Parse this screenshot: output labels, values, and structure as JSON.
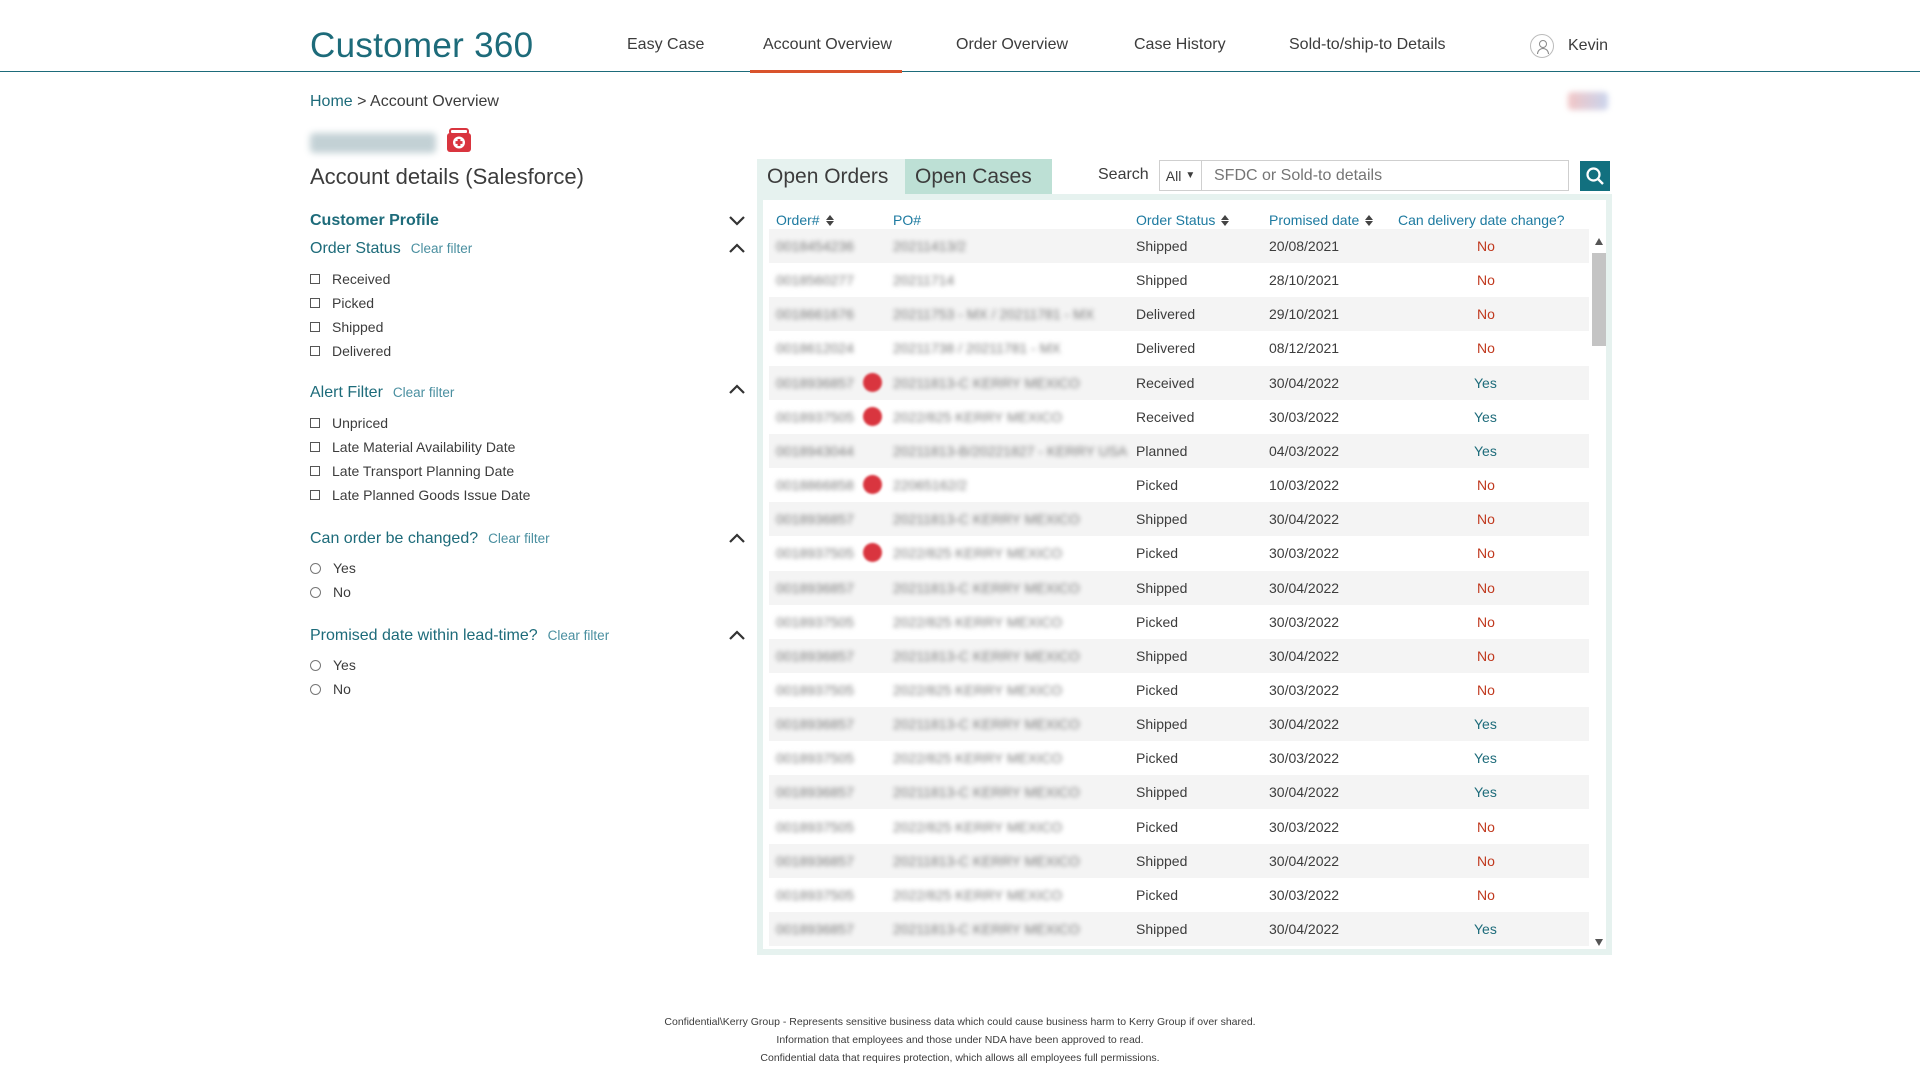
{
  "header": {
    "brand": "Customer 360",
    "nav": [
      "Easy Case",
      "Account Overview",
      "Order Overview",
      "Case History",
      "Sold-to/ship-to Details"
    ],
    "active_nav": "Account Overview",
    "user_name": "Kevin"
  },
  "breadcrumb": {
    "home": "Home",
    "separator": " > ",
    "current": "Account Overview"
  },
  "account": {
    "section_title": "Account details (Salesforce)",
    "aid_icon": "first-aid-kit-icon"
  },
  "filters": {
    "customer_profile": {
      "title": "Customer Profile"
    },
    "order_status": {
      "title": "Order Status",
      "clear": "Clear filter",
      "options": [
        "Received",
        "Picked",
        "Shipped",
        "Delivered"
      ]
    },
    "alert_filter": {
      "title": "Alert Filter",
      "clear": "Clear filter",
      "options": [
        "Unpriced",
        "Late Material Availability Date",
        "Late Transport Planning Date",
        "Late Planned Goods Issue Date"
      ]
    },
    "can_change": {
      "title": "Can order be changed?",
      "clear": "Clear filter",
      "options": [
        "Yes",
        "No"
      ]
    },
    "lead_time": {
      "title": "Promised date within lead-time?",
      "clear": "Clear filter",
      "options": [
        "Yes",
        "No"
      ]
    }
  },
  "tabs": {
    "open_orders": "Open Orders",
    "open_cases": "Open Cases"
  },
  "search": {
    "label": "Search",
    "scope": "All",
    "placeholder": "SFDC or Sold-to details"
  },
  "table": {
    "columns": {
      "order": "Order#",
      "po": "PO#",
      "status": "Order Status",
      "promised": "Promised date",
      "change": "Can delivery date change?"
    },
    "rows": [
      {
        "order": "0018454236",
        "po": "20211413/2",
        "alert": false,
        "status": "Shipped",
        "promised": "20/08/2021",
        "change": "No"
      },
      {
        "order": "0018560277",
        "po": "20211714",
        "alert": false,
        "status": "Shipped",
        "promised": "28/10/2021",
        "change": "No"
      },
      {
        "order": "0018661676",
        "po": "20211753 - MX / 20211781 - MX",
        "alert": false,
        "status": "Delivered",
        "promised": "29/10/2021",
        "change": "No"
      },
      {
        "order": "0018612024",
        "po": "20211738 / 20211781 - MX",
        "alert": false,
        "status": "Delivered",
        "promised": "08/12/2021",
        "change": "No"
      },
      {
        "order": "0018936857",
        "po": "20211813-C KERRY MEXICO",
        "alert": true,
        "status": "Received",
        "promised": "30/04/2022",
        "change": "Yes"
      },
      {
        "order": "0018937505",
        "po": "2022/825 KERRY MEXICO",
        "alert": true,
        "status": "Received",
        "promised": "30/03/2022",
        "change": "Yes"
      },
      {
        "order": "0018943044",
        "po": "20211813-B/20221827 - KERRY USA",
        "alert": false,
        "status": "Planned",
        "promised": "04/03/2022",
        "change": "Yes"
      },
      {
        "order": "0018866858",
        "po": "22065162/2",
        "alert": true,
        "status": "Picked",
        "promised": "10/03/2022",
        "change": "No"
      },
      {
        "order": "0018936857",
        "po": "20211813-C KERRY MEXICO",
        "alert": false,
        "status": "Shipped",
        "promised": "30/04/2022",
        "change": "No"
      },
      {
        "order": "0018937505",
        "po": "2022/825 KERRY MEXICO",
        "alert": true,
        "status": "Picked",
        "promised": "30/03/2022",
        "change": "No"
      },
      {
        "order": "0018936857",
        "po": "20211813-C KERRY MEXICO",
        "alert": false,
        "status": "Shipped",
        "promised": "30/04/2022",
        "change": "No"
      },
      {
        "order": "0018937505",
        "po": "2022/825 KERRY MEXICO",
        "alert": false,
        "status": "Picked",
        "promised": "30/03/2022",
        "change": "No"
      },
      {
        "order": "0018936857",
        "po": "20211813-C KERRY MEXICO",
        "alert": false,
        "status": "Shipped",
        "promised": "30/04/2022",
        "change": "No"
      },
      {
        "order": "0018937505",
        "po": "2022/825 KERRY MEXICO",
        "alert": false,
        "status": "Picked",
        "promised": "30/03/2022",
        "change": "No"
      },
      {
        "order": "0018936857",
        "po": "20211813-C KERRY MEXICO",
        "alert": false,
        "status": "Shipped",
        "promised": "30/04/2022",
        "change": "Yes"
      },
      {
        "order": "0018937505",
        "po": "2022/825 KERRY MEXICO",
        "alert": false,
        "status": "Picked",
        "promised": "30/03/2022",
        "change": "Yes"
      },
      {
        "order": "0018936857",
        "po": "20211813-C KERRY MEXICO",
        "alert": false,
        "status": "Shipped",
        "promised": "30/04/2022",
        "change": "Yes"
      },
      {
        "order": "0018937505",
        "po": "2022/825 KERRY MEXICO",
        "alert": false,
        "status": "Picked",
        "promised": "30/03/2022",
        "change": "No"
      },
      {
        "order": "0018936857",
        "po": "20211813-C KERRY MEXICO",
        "alert": false,
        "status": "Shipped",
        "promised": "30/04/2022",
        "change": "No"
      },
      {
        "order": "0018937505",
        "po": "2022/825 KERRY MEXICO",
        "alert": false,
        "status": "Picked",
        "promised": "30/03/2022",
        "change": "No"
      },
      {
        "order": "0018936857",
        "po": "20211813-C KERRY MEXICO",
        "alert": false,
        "status": "Shipped",
        "promised": "30/04/2022",
        "change": "Yes"
      }
    ]
  },
  "footer": [
    "Confidential\\Kerry Group - Represents sensitive business data which could cause business harm to Kerry Group if over shared.",
    "Information that employees and those under NDA have been approved to read.",
    "Confidential data that requires protection, which allows all employees full permissions."
  ],
  "colors": {
    "brand": "#1d6b7a",
    "active_underline": "#d9532c",
    "yes": "#1d6b7a",
    "no": "#c0391e",
    "tab_orders": "#e6f2ef",
    "tab_cases": "#bde0d5",
    "search_button": "#12707f"
  }
}
